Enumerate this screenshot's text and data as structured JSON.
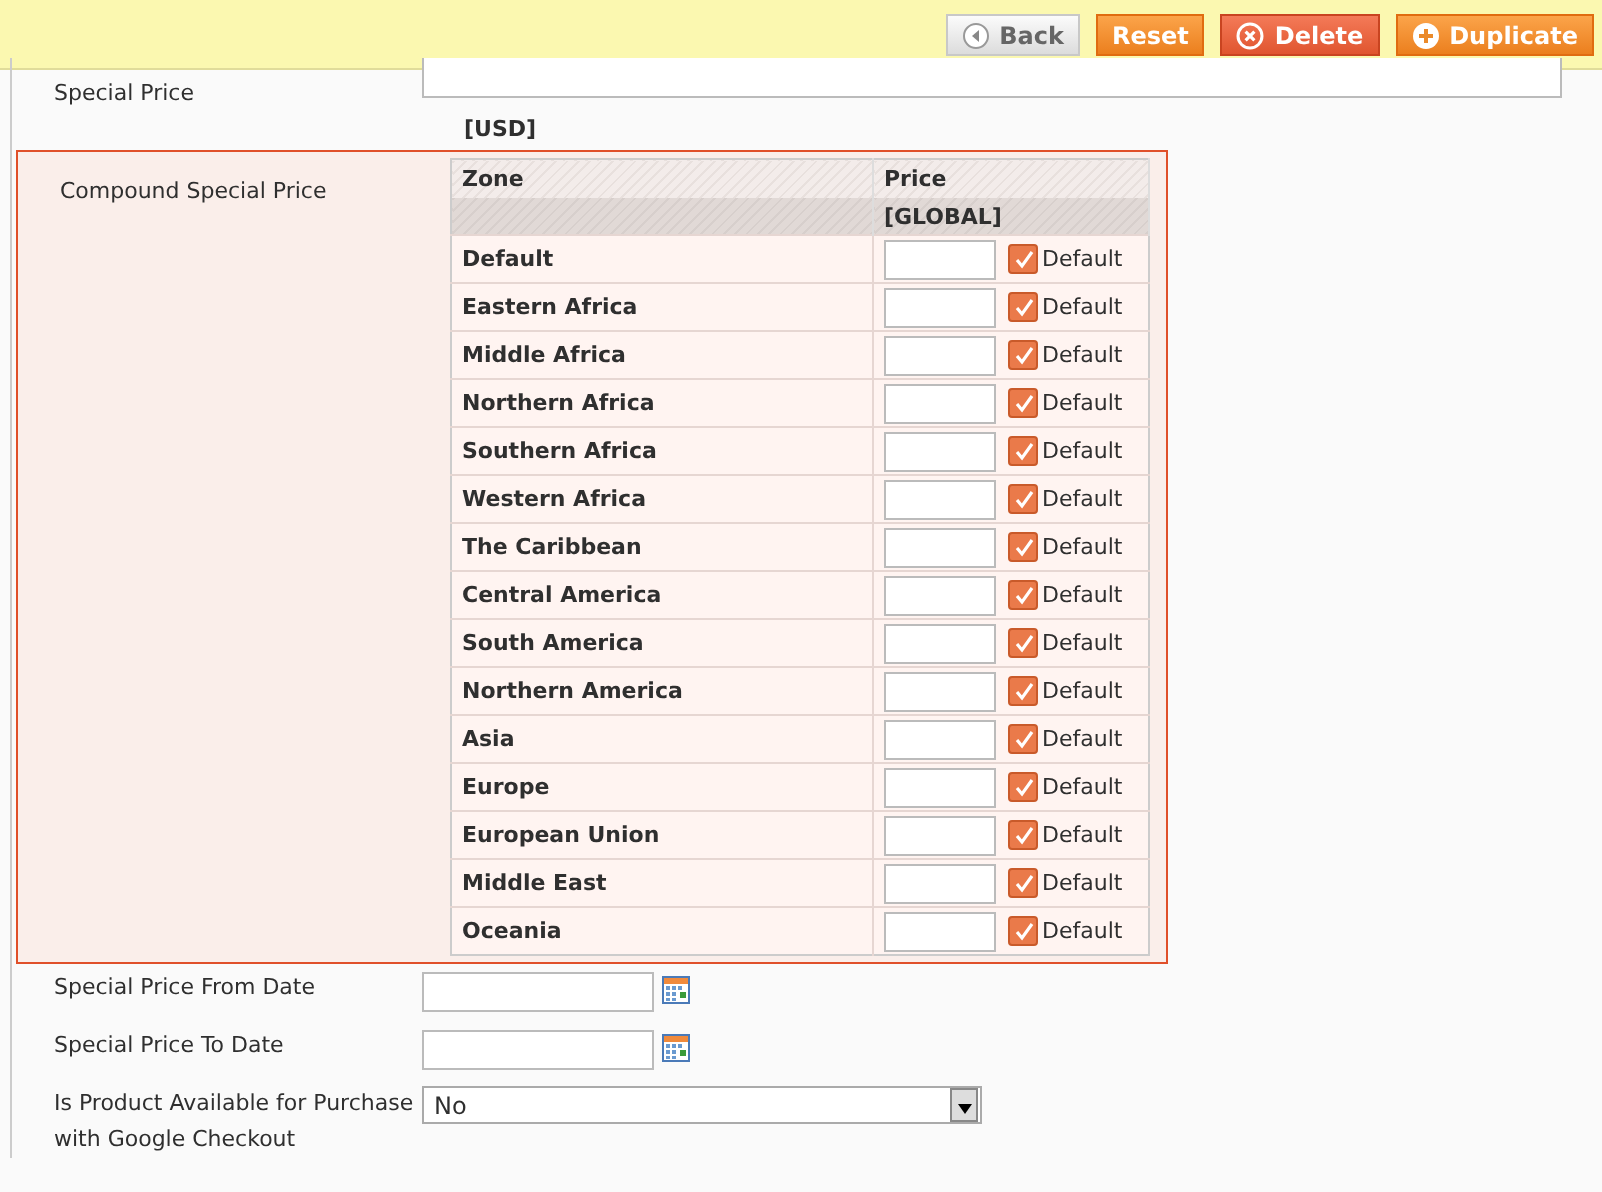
{
  "toolbar": {
    "buttons": [
      {
        "label": "Back",
        "kind": "back"
      },
      {
        "label": "Reset",
        "kind": "plain"
      },
      {
        "label": "Delete",
        "kind": "delete"
      },
      {
        "label": "Duplicate",
        "kind": "add"
      }
    ]
  },
  "special_price": {
    "label": "Special Price",
    "currency": "[USD]"
  },
  "compound": {
    "label": "Compound Special Price",
    "columns": [
      "Zone",
      "Price"
    ],
    "scope": "[GLOBAL]",
    "zones": [
      {
        "name": "Default",
        "use_default": true,
        "default_label": "Default"
      },
      {
        "name": "Eastern Africa",
        "use_default": true,
        "default_label": "Default"
      },
      {
        "name": "Middle Africa",
        "use_default": true,
        "default_label": "Default"
      },
      {
        "name": "Northern Africa",
        "use_default": true,
        "default_label": "Default"
      },
      {
        "name": "Southern Africa",
        "use_default": true,
        "default_label": "Default"
      },
      {
        "name": "Western Africa",
        "use_default": true,
        "default_label": "Default"
      },
      {
        "name": "The Caribbean",
        "use_default": true,
        "default_label": "Default"
      },
      {
        "name": "Central America",
        "use_default": true,
        "default_label": "Default"
      },
      {
        "name": "South America",
        "use_default": true,
        "default_label": "Default"
      },
      {
        "name": "Northern America",
        "use_default": true,
        "default_label": "Default"
      },
      {
        "name": "Asia",
        "use_default": true,
        "default_label": "Default"
      },
      {
        "name": "Europe",
        "use_default": true,
        "default_label": "Default"
      },
      {
        "name": "European Union",
        "use_default": true,
        "default_label": "Default"
      },
      {
        "name": "Middle East",
        "use_default": true,
        "default_label": "Default"
      },
      {
        "name": "Oceania",
        "use_default": true,
        "default_label": "Default"
      }
    ]
  },
  "fields": [
    {
      "kind": "date",
      "label": "Special Price From Date"
    },
    {
      "kind": "date",
      "label": "Special Price To Date"
    },
    {
      "kind": "select",
      "label": "Is Product Available for Purchase with Google Checkout",
      "value": "No"
    }
  ]
}
